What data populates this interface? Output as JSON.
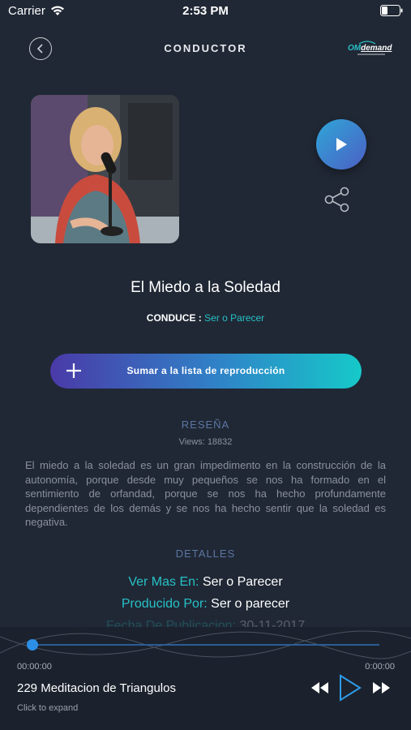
{
  "status_bar": {
    "carrier": "Carrier",
    "time": "2:53 PM"
  },
  "nav": {
    "title": "CONDUCTOR",
    "logo_om": "OM",
    "logo_demand": "demand"
  },
  "episode": {
    "title": "El Miedo a la Soledad",
    "host_label": "CONDUCE :",
    "host_value": "Ser o Parecer"
  },
  "add_button_label": "Sumar a la lista de reproducción",
  "review": {
    "heading": "RESEÑA",
    "views": "Views: 18832",
    "text": "El miedo a la soledad es un gran impedimento en la construcción de la autonomía, porque desde muy pequeños se nos ha formado en el sentimiento de orfandad, porque se nos ha hecho profundamente dependientes de los demás y se nos ha hecho sentir que la soledad es negativa."
  },
  "details": {
    "heading": "DETALLES",
    "rows": [
      {
        "label": "Ver Mas En:",
        "value": "Ser o Parecer"
      },
      {
        "label": "Producido Por:",
        "value": "Ser o parecer"
      },
      {
        "label": "Fecha De Publicacion:",
        "value": "30-11-2017"
      }
    ]
  },
  "player": {
    "elapsed": "00:00:00",
    "total": "0:00:00",
    "progress": 0,
    "track_title": "229 Meditacion de Triangulos",
    "expand_hint": "Click to expand"
  },
  "colors": {
    "background": "#202835",
    "accent": "#27c1c7",
    "section_heading": "#5c76a3"
  },
  "icons": [
    "wifi-icon",
    "battery-icon",
    "back-icon",
    "play-icon",
    "share-icon",
    "plus-icon",
    "rewind-icon",
    "forward-icon"
  ]
}
